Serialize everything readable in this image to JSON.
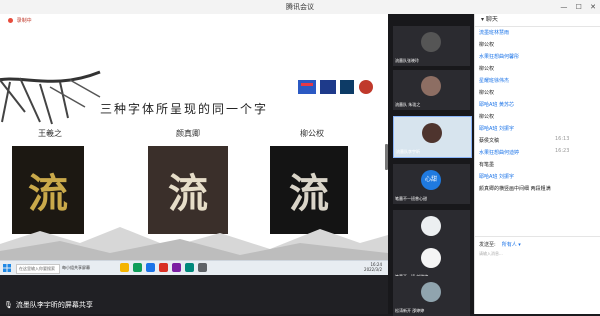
{
  "window": {
    "title": "腾讯会议"
  },
  "titlebar_icons": [
    "minimize-icon",
    "maximize-icon",
    "close-icon"
  ],
  "recording": {
    "label": "录制中"
  },
  "slide": {
    "title": "三种字体所呈现的同一个字",
    "calligraphers": [
      {
        "name": "王羲之",
        "glyph": "流"
      },
      {
        "name": "颜真卿",
        "glyph": "流"
      },
      {
        "name": "柳公权",
        "glyph": "流"
      }
    ]
  },
  "taskbar": {
    "search_placeholder": "在这里输入你要搜索",
    "task_label": "每小组共享屏幕",
    "time": "16:24",
    "date": "2022/3/2"
  },
  "share_label": "流墨队李宇昕的屏幕共享",
  "videos": [
    {
      "label": "流墨队张晓玲"
    },
    {
      "label": "流墨队 朱珑之"
    },
    {
      "label": "流墨队李宇昕"
    },
    {
      "label": "笔墨不一班曾心甜",
      "initials": "心甜"
    },
    {
      "label": "笔墨不一班 刘晓婷"
    },
    {
      "label": "笔墨不一班 刘晓婷"
    },
    {
      "label": "松涛新开 邵婷婷"
    }
  ],
  "chat": {
    "header": "聊天",
    "messages": [
      {
        "kind": "sender",
        "text": "流墨班林慧雨"
      },
      {
        "kind": "text",
        "text": "柳公权"
      },
      {
        "kind": "sender",
        "text": "水果狂想曲何馨彤"
      },
      {
        "kind": "text",
        "text": "柳公权"
      },
      {
        "kind": "sender",
        "text": "星耀班徐伟杰"
      },
      {
        "kind": "text",
        "text": "柳公权"
      },
      {
        "kind": "sender",
        "text": "耶哈A班 黄苏芯"
      },
      {
        "kind": "text",
        "text": "柳公权"
      },
      {
        "kind": "sender",
        "text": "耶哈A班 刘振宇"
      },
      {
        "kind": "time",
        "text": "16:13"
      },
      {
        "kind": "text",
        "text": "蔡侯文稿"
      },
      {
        "kind": "time",
        "text": "16:23"
      },
      {
        "kind": "sender",
        "text": "水果狂想曲何迪婷"
      },
      {
        "kind": "text",
        "text": "有笔墨"
      },
      {
        "kind": "sender",
        "text": "耶哈A班 刘振宇"
      },
      {
        "kind": "text",
        "text": "颜真卿的横竖画中间细 两段粗满"
      }
    ],
    "send_to_label": "发送至:",
    "send_to_target": "所有人 ▾",
    "input_placeholder": "请输入消息..."
  }
}
